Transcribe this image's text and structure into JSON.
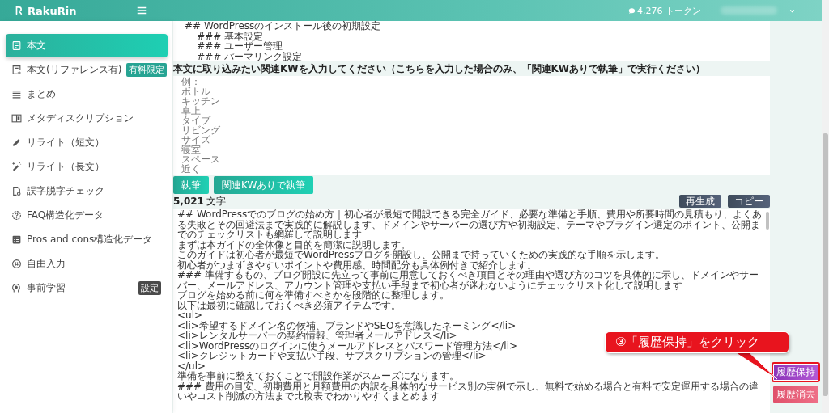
{
  "header": {
    "brand": "RakuRin",
    "tokens": "4,276 トークン"
  },
  "sidebar": {
    "items": [
      {
        "label": "本文",
        "selected": true
      },
      {
        "label": "本文(リファレンス有)",
        "selected": false,
        "badge": {
          "text": "有料限定",
          "kind": "paid"
        }
      },
      {
        "label": "まとめ",
        "selected": false
      },
      {
        "label": "メタディスクリプション",
        "selected": false
      },
      {
        "label": "リライト（短文）",
        "selected": false
      },
      {
        "label": "リライト（長文）",
        "selected": false
      },
      {
        "label": "誤字脱字チェック",
        "selected": false
      },
      {
        "label": "FAQ構造化データ",
        "selected": false
      },
      {
        "label": "Pros and cons構造化データ",
        "selected": false
      },
      {
        "label": "自由入力",
        "selected": false
      },
      {
        "label": "事前学習",
        "selected": false,
        "badge": {
          "text": "設定",
          "kind": "setting"
        }
      }
    ]
  },
  "previous_output": {
    "lines": [
      "## WordPressのインストール後の初期設定",
      "    ### 基本設定",
      "    ### ユーザー管理",
      "    ### パーマリンク設定"
    ]
  },
  "keywords": {
    "label": "本文に取り込みたい関連KWを入力してください（こちらを入力した場合のみ、「関連KWありで執筆」で実行ください）",
    "placeholder": [
      "例：",
      "ボトル",
      "キッチン",
      "卓上",
      "タイプ",
      "リビング",
      "サイズ",
      "寝室",
      "スペース",
      "近く"
    ]
  },
  "actions": [
    {
      "label": "執筆"
    },
    {
      "label": "関連KWありで執筆"
    }
  ],
  "result": {
    "count": "5,021",
    "unit": "文字",
    "buttons": [
      {
        "label": "再生成"
      },
      {
        "label": "コピー"
      }
    ],
    "paragraphs": [
      "## WordPressでのブログの始め方｜初心者が最短で開設できる完全ガイド、必要な準備と手順、費用や所要時間の見積もり、よくある失敗とその回避法まで実践的に解説します、ドメインやサーバーの選び方や初期設定、テーマやプラグイン選定のポイント、公開までのチェックリストも網羅して説明します",
      "まずは本ガイドの全体像と目的を簡潔に説明します。",
      "このガイドは初心者が最短でWordPressブログを開設し、公開まで持っていくための実践的な手順を示します。",
      "初心者がつまずきやすいポイントや費用感、時間配分も具体例付きで紹介します。",
      "### 準備するもの、ブログ開設に先立って事前に用意しておくべき項目とその理由や選び方のコツを具体的に示し、ドメインやサーバー、メールアドレス、アカウント管理や支払い手段まで初心者が迷わないようにチェックリスト化して説明します",
      "ブログを始める前に何を準備すべきかを段階的に整理します。",
      "以下は最初に確認しておくべき必須アイテムです。",
      "<ul>\n<li>希望するドメイン名の候補、ブランドやSEOを意識したネーミング</li>\n<li>レンタルサーバーの契約情報、管理者メールアドレス</li>\n<li>WordPressのログインに使うメールアドレスとパスワード管理方法</li>\n<li>クレジットカードや支払い手段、サブスクリプションの管理</li>\n</ul>",
      "準備を事前に整えておくことで開設作業がスムーズになります。",
      "### 費用の目安、初期費用と月額費用の内訳を具体的なサービス別の実例で示し、無料で始める場合と有料で安定運用する場合の違いやコスト削減の方法まで比較表でわかりやすくまとめます"
    ]
  },
  "history_buttons": [
    {
      "label": "履歴保持",
      "kind": "keep",
      "highlighted": true
    },
    {
      "label": "履歴消去",
      "kind": "clear",
      "highlighted": false
    }
  ],
  "callout": {
    "text": "③「履歴保持」をクリック"
  }
}
